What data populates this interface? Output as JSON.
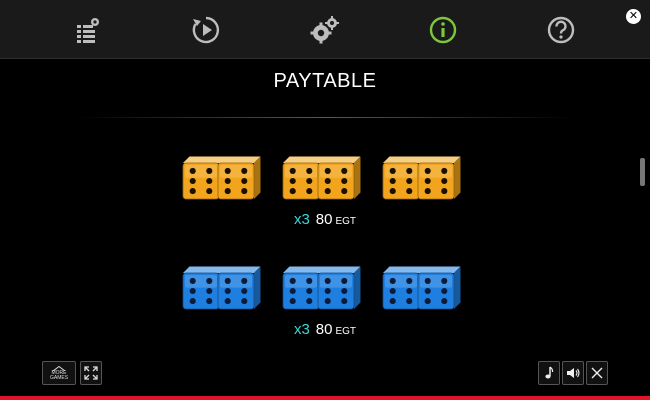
{
  "title": "PAYTABLE",
  "tabs": [
    {
      "name": "paytable-tab",
      "icon": "list-gear-icon",
      "active": false
    },
    {
      "name": "autoplay-tab",
      "icon": "replay-icon",
      "active": false
    },
    {
      "name": "settings-tab",
      "icon": "gears-icon",
      "active": false
    },
    {
      "name": "info-tab",
      "icon": "info-icon",
      "active": true
    },
    {
      "name": "help-tab",
      "icon": "question-icon",
      "active": false
    }
  ],
  "colors": {
    "active_tab": "#7ec63a",
    "inactive_tab": "#bdbdbd",
    "multiplier": "#3fd6d6",
    "gold_die": "#f2a51c",
    "blue_die": "#1f7fe0",
    "bottom_bar": "#e3142a"
  },
  "paylines": [
    {
      "symbol": "gold-dice",
      "multiplier": "x3",
      "amount": "80",
      "unit": "EGT"
    },
    {
      "symbol": "blue-dice",
      "multiplier": "x3",
      "amount": "80",
      "unit": "EGT"
    }
  ],
  "footer": {
    "more_games_label": "MORE GAMES"
  }
}
